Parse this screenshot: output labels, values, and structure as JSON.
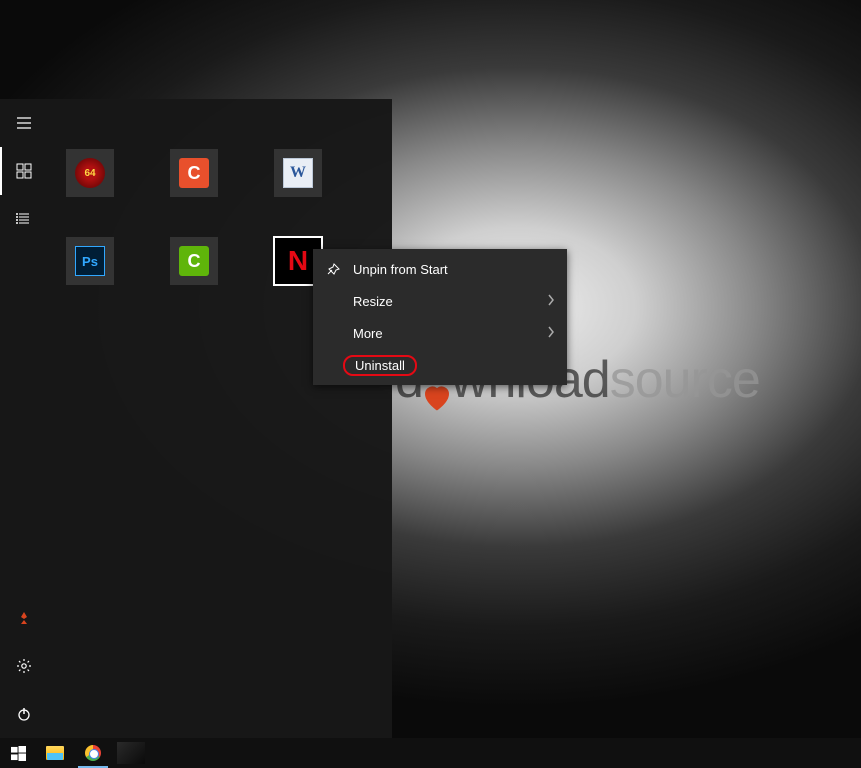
{
  "watermark": {
    "part1": "d",
    "part2": "wnload",
    "part3": "source"
  },
  "start_rail": {
    "top": [
      {
        "name": "hamburger-icon"
      },
      {
        "name": "pinned-tiles-icon",
        "active": true
      },
      {
        "name": "all-apps-icon"
      }
    ],
    "bottom": [
      {
        "name": "user-app-icon"
      },
      {
        "name": "settings-icon"
      },
      {
        "name": "power-icon"
      }
    ]
  },
  "tiles": {
    "row1": [
      {
        "name": "tile-aida64",
        "label": "64"
      },
      {
        "name": "tile-snip",
        "label": "C"
      },
      {
        "name": "tile-word",
        "label": "W"
      }
    ],
    "row2": [
      {
        "name": "tile-photoshop",
        "label": "Ps"
      },
      {
        "name": "tile-camtasia",
        "label": "C"
      },
      {
        "name": "tile-netflix",
        "label": "N",
        "selected": true
      }
    ]
  },
  "context_menu": {
    "items": [
      {
        "id": "unpin",
        "label": "Unpin from Start",
        "has_icon": true,
        "has_chevron": false,
        "highlighted": false
      },
      {
        "id": "resize",
        "label": "Resize",
        "has_icon": false,
        "has_chevron": true,
        "highlighted": false
      },
      {
        "id": "more",
        "label": "More",
        "has_icon": false,
        "has_chevron": true,
        "highlighted": false
      },
      {
        "id": "uninstall",
        "label": "Uninstall",
        "has_icon": false,
        "has_chevron": false,
        "highlighted": true
      }
    ]
  },
  "taskbar": {
    "items": [
      {
        "name": "start-button"
      },
      {
        "name": "file-explorer"
      },
      {
        "name": "chrome",
        "active": true
      },
      {
        "name": "app-dark"
      }
    ]
  }
}
